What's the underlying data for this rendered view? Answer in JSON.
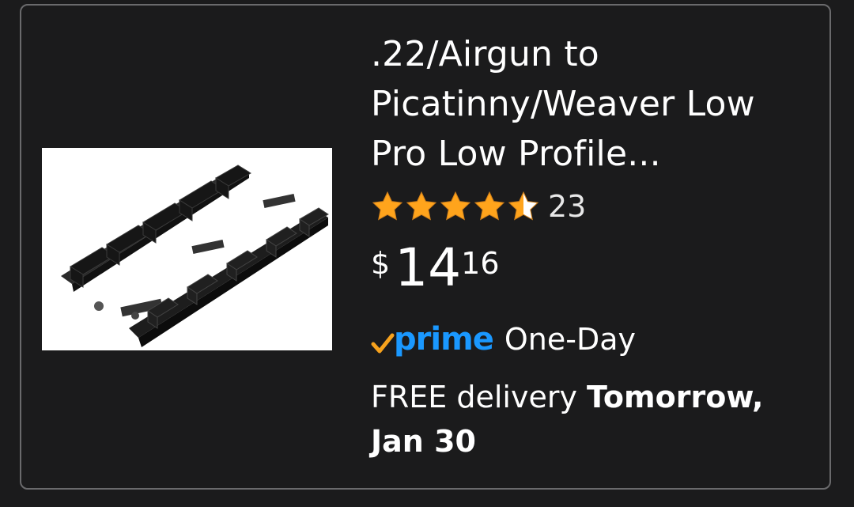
{
  "product": {
    "title": ".22/Airgun to Picatinny/Weaver Low Pro Low Profile...",
    "image_alt": "black low profile rail adapter",
    "rating": {
      "stars": 4.5,
      "max_stars": 5,
      "count": "23"
    },
    "price": {
      "symbol": "$",
      "whole": "14",
      "fraction": "16"
    },
    "prime": {
      "logo_text": "prime",
      "speed": "One-Day"
    },
    "delivery": {
      "prefix": "FREE delivery ",
      "date": "Tomorrow, Jan 30"
    }
  },
  "colors": {
    "background": "#1b1b1c",
    "border": "#6a6a6c",
    "star": "#ffa41c",
    "prime_blue": "#1a98ff",
    "prime_check": "#f7a21d"
  },
  "icons": {
    "star_full": "star-icon",
    "star_half": "star-half-icon",
    "prime_check": "prime-check-icon"
  }
}
